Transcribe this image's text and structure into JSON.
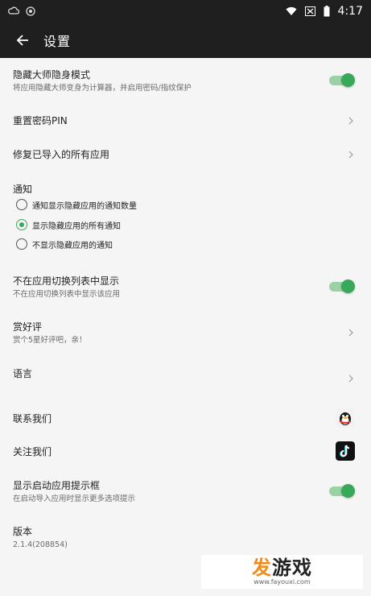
{
  "status_bar": {
    "time": "4:17"
  },
  "app_bar": {
    "title": "设置"
  },
  "settings": {
    "hide_master": {
      "title": "隐藏大师隐身模式",
      "subtitle": "将应用隐藏大师变身为计算器，并启用密码/指纹保护",
      "enabled": true
    },
    "reset_pin": {
      "title": "重置密码PIN"
    },
    "repair_apps": {
      "title": "修复已导入的所有应用"
    },
    "notifications": {
      "title": "通知",
      "options": [
        "通知显示隐藏应用的通知数量",
        "显示隐藏应用的所有通知",
        "不显示隐藏应用的通知"
      ],
      "selected": "显示隐藏应用的所有通知"
    },
    "hide_recents": {
      "title": "不在应用切换列表中显示",
      "subtitle": "不在应用切换列表中显示该应用",
      "enabled": true
    },
    "rate": {
      "title": "赏好评",
      "subtitle": "赏个5星好评吧，亲！"
    },
    "language": {
      "title": "语言"
    },
    "contact": {
      "title": "联系我们"
    },
    "follow": {
      "title": "关注我们"
    },
    "launch_tip": {
      "title": "显示启动应用提示框",
      "subtitle": "在启动导入应用时显示更多选项提示",
      "enabled": true
    },
    "version": {
      "title": "版本",
      "value": "2.1.4(208854)"
    }
  },
  "watermark": {
    "title_first": "发",
    "title_rest": "游戏",
    "url": "www.fayouxi.com"
  },
  "colors": {
    "accent": "#3aa85a",
    "bar": "#1f1f1f",
    "background": "#f5f5f5"
  }
}
